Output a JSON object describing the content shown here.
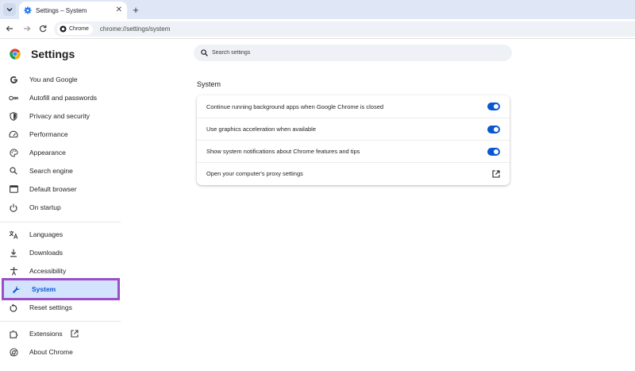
{
  "window": {
    "tab_title": "Settings – System",
    "url": "chrome://settings/system",
    "chip_label": "Chrome"
  },
  "sidebar": {
    "title": "Settings",
    "items": [
      {
        "label": "You and Google",
        "icon": "google-g-icon"
      },
      {
        "label": "Autofill and passwords",
        "icon": "key-icon"
      },
      {
        "label": "Privacy and security",
        "icon": "shield-icon"
      },
      {
        "label": "Performance",
        "icon": "speedometer-icon"
      },
      {
        "label": "Appearance",
        "icon": "palette-icon"
      },
      {
        "label": "Search engine",
        "icon": "search-icon"
      },
      {
        "label": "Default browser",
        "icon": "browser-window-icon"
      },
      {
        "label": "On startup",
        "icon": "power-icon"
      },
      {
        "label": "Languages",
        "icon": "translate-icon"
      },
      {
        "label": "Downloads",
        "icon": "download-icon"
      },
      {
        "label": "Accessibility",
        "icon": "accessibility-icon"
      },
      {
        "label": "System",
        "icon": "wrench-icon",
        "selected": true
      },
      {
        "label": "Reset settings",
        "icon": "reset-icon"
      },
      {
        "label": "Extensions",
        "icon": "puzzle-icon"
      },
      {
        "label": "About Chrome",
        "icon": "chrome-icon"
      }
    ]
  },
  "search": {
    "placeholder": "Search settings"
  },
  "main": {
    "section_title": "System",
    "rows": [
      {
        "label": "Continue running background apps when Google Chrome is closed",
        "control": "toggle",
        "on": true
      },
      {
        "label": "Use graphics acceleration when available",
        "control": "toggle",
        "on": true
      },
      {
        "label": "Show system notifications about Chrome features and tips",
        "control": "toggle",
        "on": true
      },
      {
        "label": "Open your computer's proxy settings",
        "control": "external-link-icon"
      }
    ]
  },
  "colors": {
    "accent": "#0b57d0",
    "selected_bg": "#d3e3fd",
    "highlight_border": "#9b4fc6"
  }
}
